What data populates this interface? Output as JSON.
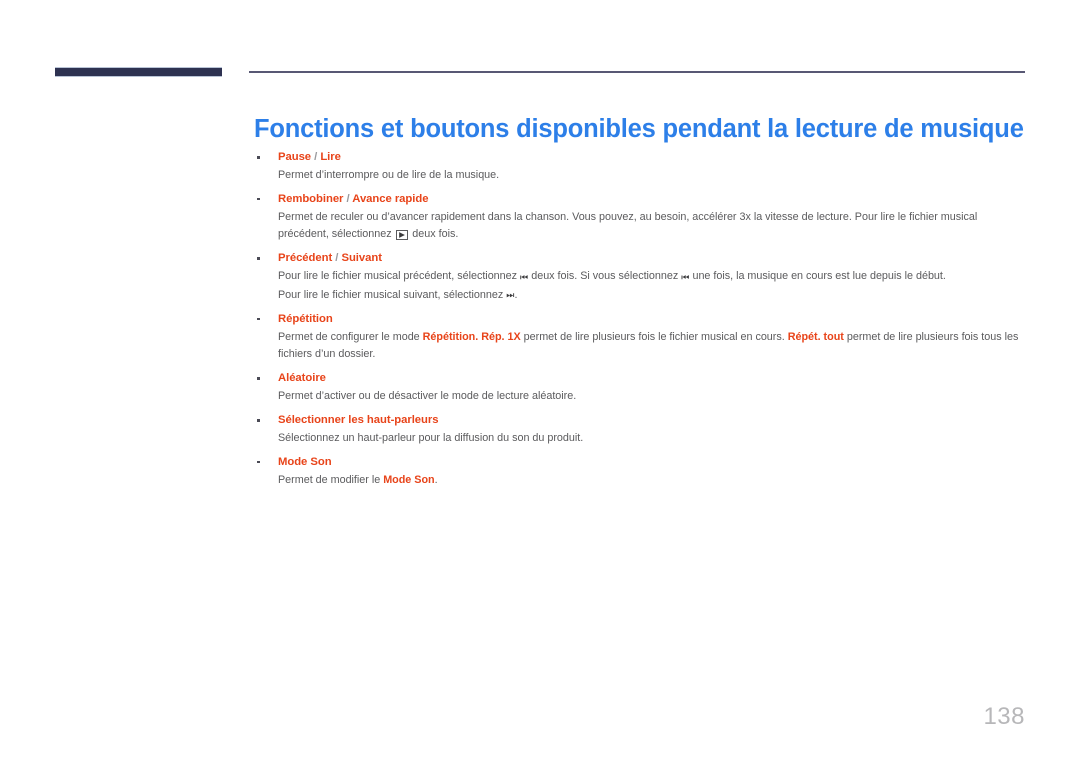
{
  "header": {
    "accent_bar_color": "#2e3251",
    "rule_color": "#585874"
  },
  "title": "Fonctions et boutons disponibles pendant la lecture de musique",
  "colors": {
    "title_blue": "#2d7fe8",
    "heading_orange": "#e8441a",
    "body_gray": "#5b5b5d",
    "page_number_gray": "#b7b7b9",
    "navy": "#2e3251"
  },
  "items": [
    {
      "head_a": "Pause",
      "separator": "/",
      "head_b": "Lire",
      "lines": [
        {
          "parts": [
            {
              "t": "Permet d’interrompre ou de lire de la musique.",
              "b": false
            }
          ]
        }
      ]
    },
    {
      "head_a": "Rembobiner",
      "separator": "/",
      "head_b": "Avance rapide",
      "lines": [
        {
          "parts": [
            {
              "t": "Permet de reculer ou d’avancer rapidement dans la chanson. Vous pouvez, au besoin, accélérer 3x la vitesse de lecture. Pour lire le fichier musical précédent, sélectionnez ",
              "b": false
            },
            {
              "icon": "play-boxed-icon",
              "g": "▶"
            },
            {
              "t": " deux fois.",
              "b": false
            }
          ]
        }
      ]
    },
    {
      "head_a": "Précédent",
      "separator": "/",
      "head_b": "Suivant",
      "lines": [
        {
          "parts": [
            {
              "t": "Pour lire le fichier musical précédent, sélectionnez ",
              "b": false
            },
            {
              "icon": "previous-track-icon",
              "g": "⏮"
            },
            {
              "t": " deux fois. Si vous sélectionnez ",
              "b": false
            },
            {
              "icon": "previous-track-icon",
              "g": "⏮"
            },
            {
              "t": " une fois, la musique en cours est lue depuis le début.",
              "b": false
            }
          ]
        },
        {
          "parts": [
            {
              "t": "Pour lire le fichier musical suivant, sélectionnez ",
              "b": false
            },
            {
              "icon": "next-track-icon",
              "g": "⏭"
            },
            {
              "t": ".",
              "b": false
            }
          ]
        }
      ]
    },
    {
      "head_a": "Répétition",
      "separator": "",
      "head_b": "",
      "lines": [
        {
          "parts": [
            {
              "t": "Permet de configurer le mode ",
              "b": false
            },
            {
              "t": "Répétition.",
              "b": true
            },
            {
              "t": " ",
              "b": false
            },
            {
              "t": "Rép. 1X",
              "b": true
            },
            {
              "t": " permet de lire plusieurs fois le fichier musical en cours. ",
              "b": false
            },
            {
              "t": "Répét. tout",
              "b": true
            },
            {
              "t": " permet de lire plusieurs fois tous les fichiers d’un dossier.",
              "b": false
            }
          ]
        }
      ]
    },
    {
      "head_a": "Aléatoire",
      "separator": "",
      "head_b": "",
      "lines": [
        {
          "parts": [
            {
              "t": "Permet d’activer ou de désactiver le mode de lecture aléatoire.",
              "b": false
            }
          ]
        }
      ]
    },
    {
      "head_a": "Sélectionner les haut-parleurs",
      "separator": "",
      "head_b": "",
      "lines": [
        {
          "parts": [
            {
              "t": "Sélectionnez un haut-parleur pour la diffusion du son du produit.",
              "b": false
            }
          ]
        }
      ]
    },
    {
      "head_a": "Mode Son",
      "separator": "",
      "head_b": "",
      "lines": [
        {
          "parts": [
            {
              "t": "Permet de modifier le ",
              "b": false
            },
            {
              "t": "Mode Son",
              "b": true
            },
            {
              "t": ".",
              "b": false
            }
          ]
        }
      ]
    }
  ],
  "page_number": "138"
}
